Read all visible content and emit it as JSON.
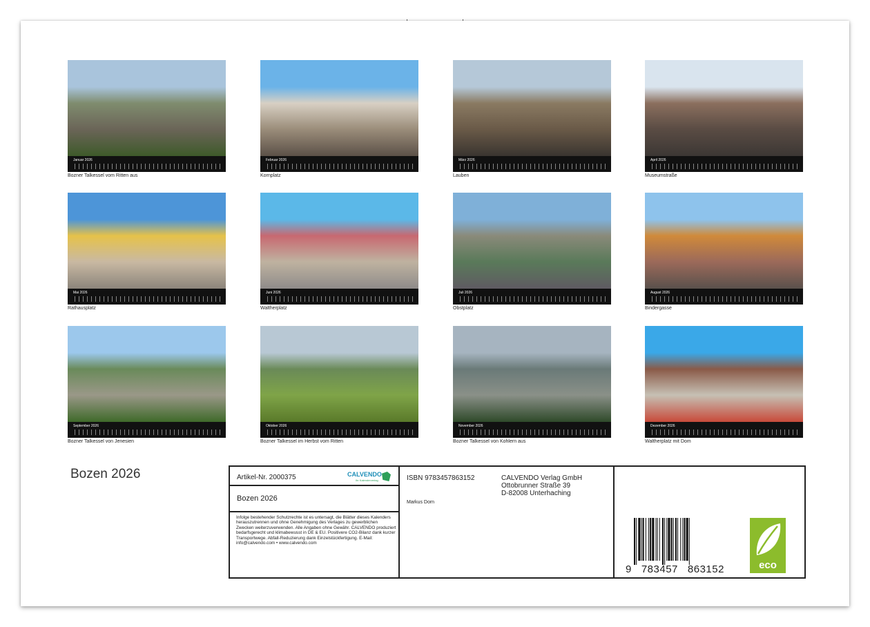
{
  "title": "Bozen 2026",
  "months": [
    {
      "month": "Januar 2026",
      "caption": "Bozner Talkessel vom Ritten aus"
    },
    {
      "month": "Februar 2026",
      "caption": "Kornplatz"
    },
    {
      "month": "März 2026",
      "caption": "Lauben"
    },
    {
      "month": "April 2026",
      "caption": "Museumstraße"
    },
    {
      "month": "Mai 2026",
      "caption": "Rathausplatz"
    },
    {
      "month": "Juni 2026",
      "caption": "Waltherplatz"
    },
    {
      "month": "Juli 2026",
      "caption": "Obstplatz"
    },
    {
      "month": "August 2026",
      "caption": "Bindergasse"
    },
    {
      "month": "September 2026",
      "caption": "Bozner Talkessel von Jenesien"
    },
    {
      "month": "Oktober 2026",
      "caption": "Bozner Talkessel im Herbst vom Ritten"
    },
    {
      "month": "November 2026",
      "caption": "Bozner Talkessel von Kohlern aus"
    },
    {
      "month": "Dezember 2026",
      "caption": "Waltherplatz mit Dom"
    }
  ],
  "info": {
    "article": "Artikel-Nr. 2000375",
    "brand": "CALVENDO",
    "brand_sub": "Ihr Kalenderverlag",
    "calendar_title": "Bozen 2026",
    "legal": "Infolge bestehender Schutzrechte ist es untersagt, die Blätter dieses Kalenders herauszutrennen und ohne Genehmigung des Verlages zu gewerblichen Zwecken weiterzuverwenden. Alle Angaben ohne Gewähr. CALVENDO produziert bedarfsgerecht und klimabewusst in DE & EU. Positivere CO2-Bilanz dank kurzer Transportwege. Abfall-Reduzierung dank Einzelstückfertigung. E-Mail: info@calvendo.com • www.calvendo.com",
    "isbn": "ISBN 9783457863152",
    "author": "Markus Dorn",
    "publisher_line1": "CALVENDO Verlag GmbH",
    "publisher_line2": "Ottobrunner Straße 39",
    "publisher_line3": "D-82008 Unterhaching",
    "barcode_number": "9   783457   863152",
    "eco_label": "eco"
  },
  "colors": {
    "eco_green": "#8cbc2c",
    "calvendo_blue": "#1f8fb8",
    "calvendo_green": "#2e9f5a"
  }
}
